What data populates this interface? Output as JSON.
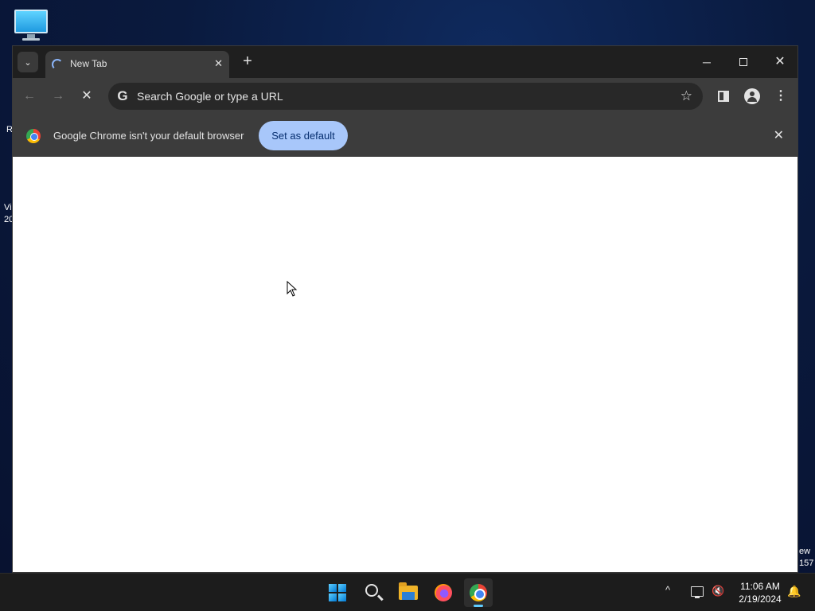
{
  "desktop": {
    "icon_name": "this-pc-icon",
    "frag_left_1": "R",
    "frag_left_2": "Vi",
    "frag_left_3": "20",
    "frag_right_1": "ew",
    "frag_right_2": "157"
  },
  "browser": {
    "tab": {
      "title": "New Tab",
      "close": "✕"
    },
    "new_tab": "+",
    "window_controls": {
      "minimize": "─",
      "close": "✕"
    },
    "toolbar": {
      "back": "←",
      "forward": "→",
      "stop": "✕",
      "omnibox_placeholder": "Search Google or type a URL",
      "google_g": "G",
      "bookmark_star": "☆",
      "menu": "⋮"
    },
    "infobar": {
      "message": "Google Chrome isn't your default browser",
      "button": "Set as default",
      "close": "✕"
    }
  },
  "taskbar": {
    "apps": [
      "start",
      "search",
      "file-explorer",
      "firefox",
      "chrome"
    ],
    "active_app": "chrome",
    "tray_chevron": "^",
    "volume": "🔇",
    "time": "11:06 AM",
    "date": "2/19/2024",
    "notification": "🔔"
  },
  "colors": {
    "titlebar": "#1f1f1f",
    "toolbar": "#3c3c3c",
    "omnibox": "#282828",
    "default_button": "#a8c7fa",
    "taskbar": "#1c1c1c"
  }
}
